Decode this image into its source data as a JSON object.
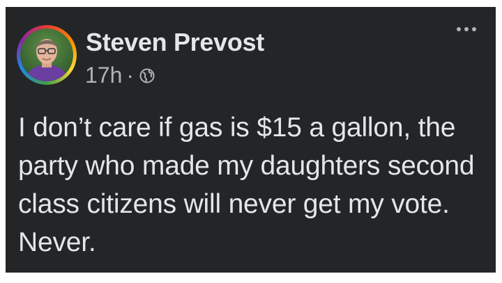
{
  "post": {
    "author": "Steven Prevost",
    "time": "17h",
    "separator": "·",
    "audience_icon": "globe-icon",
    "more_icon": "more-options-icon",
    "text": "I don’t care if gas is $15 a gallon, the party who made my daughters second class citizens will never get my vote. Never."
  },
  "colors": {
    "card_background": "#242526",
    "primary_text": "#e4e6eb",
    "secondary_text": "#b0b3b8"
  }
}
